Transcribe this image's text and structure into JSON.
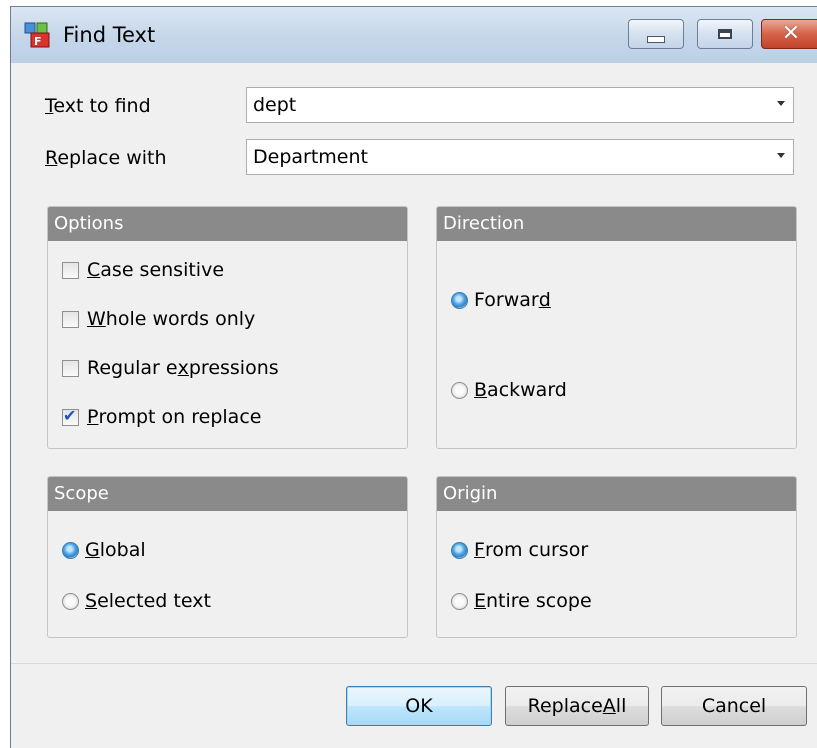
{
  "window": {
    "title": "Find Text",
    "controls": {
      "minimize": "minimize",
      "maximize": "maximize",
      "close": "✕"
    }
  },
  "fields": {
    "text_to_find": {
      "label_u": "T",
      "label_rest": "ext to find",
      "value": "dept"
    },
    "replace_with": {
      "label_u": "R",
      "label_rest": "eplace with",
      "value": "Department"
    }
  },
  "options": {
    "title": "Options",
    "items": [
      {
        "pre": "",
        "u": "C",
        "post": "ase sensitive",
        "checked": false
      },
      {
        "pre": "",
        "u": "W",
        "post": "hole words only",
        "checked": false
      },
      {
        "pre": "Regular e",
        "u": "x",
        "post": "pressions",
        "checked": false
      },
      {
        "pre": "",
        "u": "P",
        "post": "rompt on replace",
        "checked": true
      }
    ]
  },
  "direction": {
    "title": "Direction",
    "items": [
      {
        "pre": "Forwar",
        "u": "d",
        "post": "",
        "selected": true
      },
      {
        "pre": "",
        "u": "B",
        "post": "ackward",
        "selected": false
      }
    ]
  },
  "scope": {
    "title": "Scope",
    "items": [
      {
        "pre": "",
        "u": "G",
        "post": "lobal",
        "selected": true
      },
      {
        "pre": "",
        "u": "S",
        "post": "elected text",
        "selected": false
      }
    ]
  },
  "origin": {
    "title": "Origin",
    "items": [
      {
        "pre": "",
        "u": "F",
        "post": "rom cursor",
        "selected": true
      },
      {
        "pre": "",
        "u": "E",
        "post": "ntire scope",
        "selected": false
      }
    ]
  },
  "buttons": {
    "ok": "OK",
    "replace_all": {
      "pre": "Replace ",
      "u": "A",
      "post": "ll"
    },
    "cancel": "Cancel"
  }
}
